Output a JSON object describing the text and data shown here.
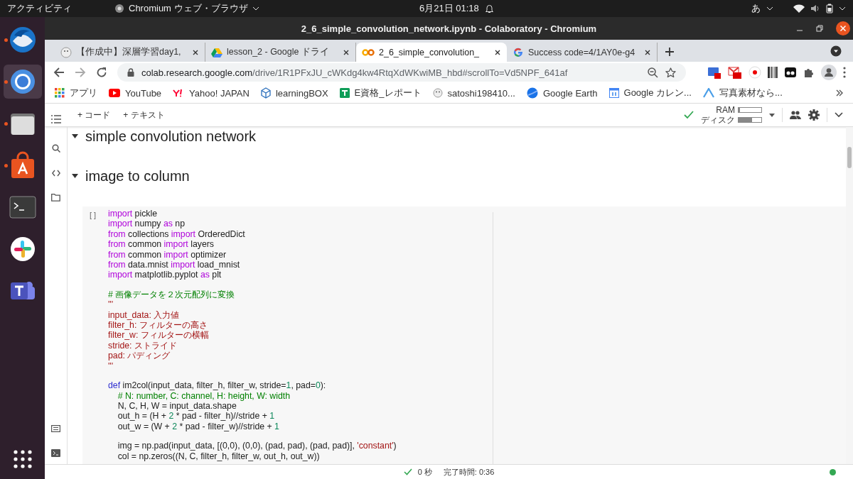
{
  "top_bar": {
    "activities": "アクティビティ",
    "app_menu": "Chromium ウェブ・ブラウザ",
    "clock": "6月21日  01:18",
    "input_method": "あ"
  },
  "dock": [
    {
      "kind": "mail",
      "running": true,
      "selected": false
    },
    {
      "kind": "browser",
      "running": true,
      "selected": true
    },
    {
      "kind": "files",
      "running": true,
      "selected": false
    },
    {
      "kind": "store",
      "running": true,
      "selected": false
    },
    {
      "kind": "terminal",
      "running": false,
      "selected": false
    },
    {
      "kind": "chat",
      "running": false,
      "selected": false
    },
    {
      "kind": "teams",
      "running": false,
      "selected": false
    }
  ],
  "window": {
    "title": "2_6_simple_convolution_network.ipynb - Colaboratory - Chromium"
  },
  "tabs": [
    {
      "label": "【作成中】深層学習day1,",
      "kind": "bird",
      "selected": false
    },
    {
      "label": "lesson_2 - Google ドライ",
      "kind": "drive",
      "selected": false
    },
    {
      "label": "2_6_simple_convolution_",
      "kind": "colab",
      "selected": true
    },
    {
      "label": "Success code=4/1AY0e-g4",
      "kind": "google",
      "selected": false
    }
  ],
  "address": {
    "host": "colab.research.google.com",
    "path": "/drive/1R1PFxJU_cWKdg4kw4RtqXdWKwiMB_hbd#scrollTo=Vd5NPF_641af"
  },
  "bookmarks": [
    {
      "label": "アプリ",
      "kind": "apps"
    },
    {
      "label": "YouTube",
      "kind": "youtube"
    },
    {
      "label": "Yahoo! JAPAN",
      "kind": "yahoo"
    },
    {
      "label": "learningBOX",
      "kind": "cube"
    },
    {
      "label": "E資格_レポート",
      "kind": "sheet"
    },
    {
      "label": "satoshi198410...",
      "kind": "bird"
    },
    {
      "label": "Google Earth",
      "kind": "earth"
    },
    {
      "label": "Google カレン...",
      "kind": "calendar"
    },
    {
      "label": "写真素材なら...",
      "kind": "peak"
    }
  ],
  "colab_toolbar": {
    "add_code": "+ コード",
    "add_text": "+ テキスト",
    "ram_label": "RAM",
    "disk_label": "ディスク",
    "ram": {
      "level": 0.05
    },
    "disk": {
      "level": 0.6
    }
  },
  "headings": [
    {
      "text": "simple convolution network",
      "expanded": true
    },
    {
      "text": "image to column",
      "expanded": true
    }
  ],
  "cell": {
    "run_indicator": "[ ]",
    "lines": [
      {
        "kind": "code",
        "tokens": [
          {
            "kind": "kw",
            "text": "import"
          },
          {
            "kind": "plain",
            "text": " pickle"
          }
        ]
      },
      {
        "kind": "code",
        "tokens": [
          {
            "kind": "kw",
            "text": "import"
          },
          {
            "kind": "plain",
            "text": " numpy "
          },
          {
            "kind": "kw",
            "text": "as"
          },
          {
            "kind": "plain",
            "text": " np"
          }
        ]
      },
      {
        "kind": "code",
        "tokens": [
          {
            "kind": "kw",
            "text": "from"
          },
          {
            "kind": "plain",
            "text": " collections "
          },
          {
            "kind": "kw",
            "text": "import"
          },
          {
            "kind": "plain",
            "text": " OrderedDict"
          }
        ]
      },
      {
        "kind": "code",
        "tokens": [
          {
            "kind": "kw",
            "text": "from"
          },
          {
            "kind": "plain",
            "text": " common "
          },
          {
            "kind": "kw",
            "text": "import"
          },
          {
            "kind": "plain",
            "text": " layers"
          }
        ]
      },
      {
        "kind": "code",
        "tokens": [
          {
            "kind": "kw",
            "text": "from"
          },
          {
            "kind": "plain",
            "text": " common "
          },
          {
            "kind": "kw",
            "text": "import"
          },
          {
            "kind": "plain",
            "text": " optimizer"
          }
        ]
      },
      {
        "kind": "code",
        "tokens": [
          {
            "kind": "kw",
            "text": "from"
          },
          {
            "kind": "plain",
            "text": " data.mnist "
          },
          {
            "kind": "kw",
            "text": "import"
          },
          {
            "kind": "plain",
            "text": " load_mnist"
          }
        ]
      },
      {
        "kind": "code",
        "tokens": [
          {
            "kind": "kw",
            "text": "import"
          },
          {
            "kind": "plain",
            "text": " matplotlib.pyplot "
          },
          {
            "kind": "kw",
            "text": "as"
          },
          {
            "kind": "plain",
            "text": " plt"
          }
        ]
      },
      {
        "kind": "blank"
      },
      {
        "kind": "code",
        "tokens": [
          {
            "kind": "comment",
            "text": "# 画像データを２次元配列に変換"
          }
        ]
      },
      {
        "kind": "code",
        "tokens": [
          {
            "kind": "string",
            "text": "'''"
          }
        ]
      },
      {
        "kind": "code",
        "tokens": [
          {
            "kind": "string",
            "text": "input_data: 入力値"
          }
        ]
      },
      {
        "kind": "code",
        "tokens": [
          {
            "kind": "string",
            "text": "filter_h: フィルターの高さ"
          }
        ]
      },
      {
        "kind": "code",
        "tokens": [
          {
            "kind": "string",
            "text": "filter_w: フィルターの横幅"
          }
        ]
      },
      {
        "kind": "code",
        "tokens": [
          {
            "kind": "string",
            "text": "stride: ストライド"
          }
        ]
      },
      {
        "kind": "code",
        "tokens": [
          {
            "kind": "string",
            "text": "pad: パディング"
          }
        ]
      },
      {
        "kind": "code",
        "tokens": [
          {
            "kind": "string",
            "text": "'''"
          }
        ]
      },
      {
        "kind": "blank"
      },
      {
        "kind": "code",
        "tokens": [
          {
            "kind": "def",
            "text": "def"
          },
          {
            "kind": "plain",
            "text": " im2col(input_data, filter_h, filter_w, stride="
          },
          {
            "kind": "number",
            "text": "1"
          },
          {
            "kind": "plain",
            "text": ", pad="
          },
          {
            "kind": "number",
            "text": "0"
          },
          {
            "kind": "plain",
            "text": "):"
          }
        ]
      },
      {
        "kind": "code",
        "tokens": [
          {
            "kind": "comment",
            "text": "    # N: number, C: channel, H: height, W: width"
          }
        ]
      },
      {
        "kind": "code",
        "tokens": [
          {
            "kind": "plain",
            "text": "    N, C, H, W = input_data.shape"
          }
        ]
      },
      {
        "kind": "code",
        "tokens": [
          {
            "kind": "plain",
            "text": "    out_h = (H + "
          },
          {
            "kind": "number",
            "text": "2"
          },
          {
            "kind": "plain",
            "text": " * pad - filter_h)//stride + "
          },
          {
            "kind": "number",
            "text": "1"
          }
        ]
      },
      {
        "kind": "code",
        "tokens": [
          {
            "kind": "plain",
            "text": "    out_w = (W + "
          },
          {
            "kind": "number",
            "text": "2"
          },
          {
            "kind": "plain",
            "text": " * pad - filter_w)//stride + "
          },
          {
            "kind": "number",
            "text": "1"
          }
        ]
      },
      {
        "kind": "blank"
      },
      {
        "kind": "code",
        "tokens": [
          {
            "kind": "plain",
            "text": "    img = np.pad(input_data, [(0,0), (0,0), (pad, pad), (pad, pad)], "
          },
          {
            "kind": "string",
            "text": "'constant'"
          },
          {
            "kind": "plain",
            "text": ")"
          }
        ]
      },
      {
        "kind": "code",
        "tokens": [
          {
            "kind": "plain",
            "text": "    col = np.zeros((N, C, filter_h, filter_w, out_h, out_w))"
          }
        ]
      }
    ]
  },
  "status_bar": {
    "elapsed": "0 秒",
    "completed": "完了時間: 0:36",
    "connected": true
  }
}
